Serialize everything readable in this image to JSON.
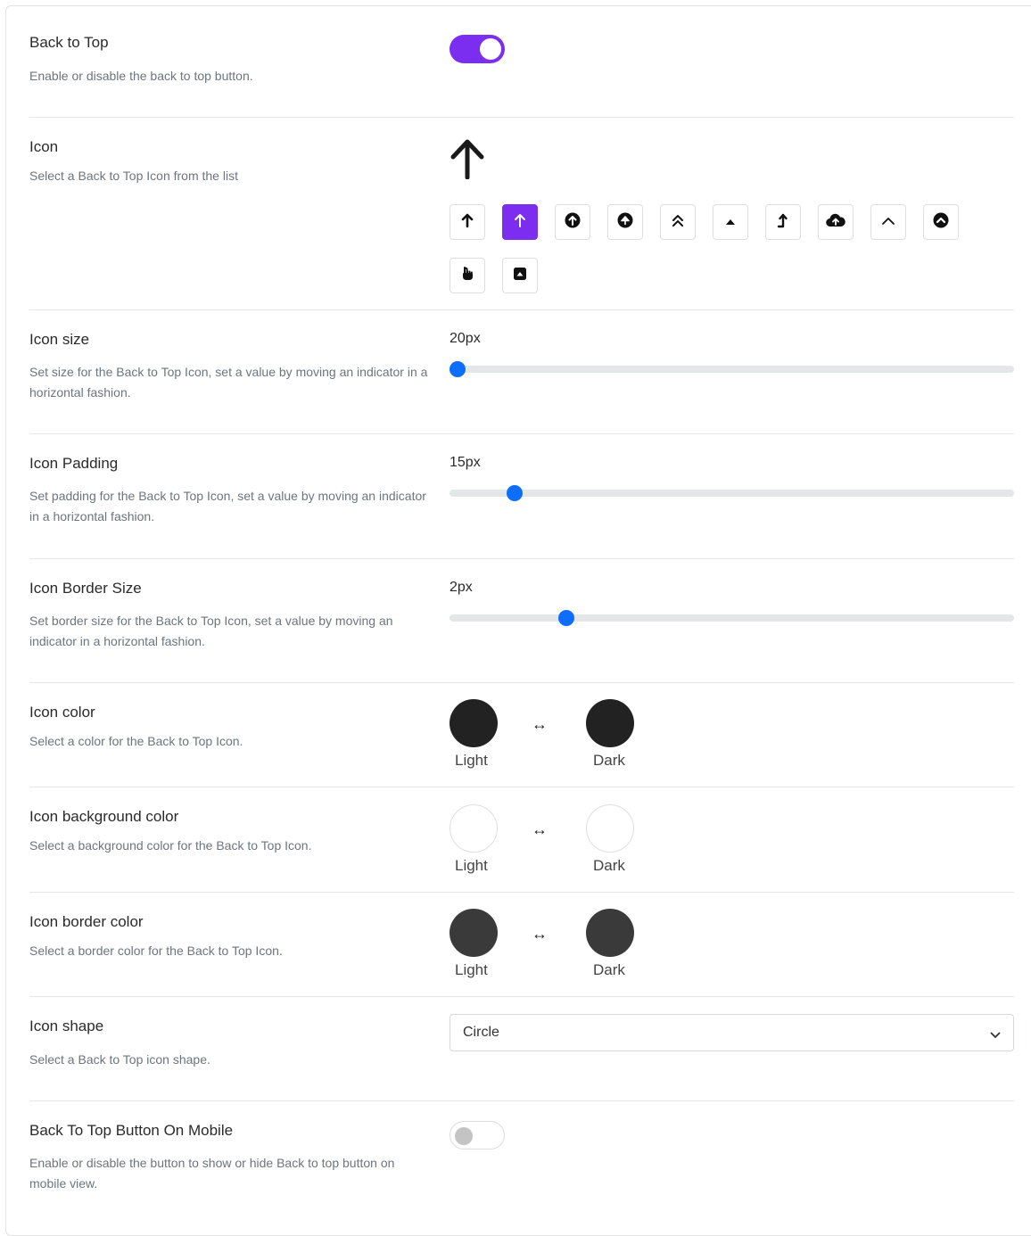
{
  "back_to_top": {
    "label": "Back to Top",
    "description": "Enable or disable the back to top button.",
    "enabled": true,
    "toggle_color": "#7c2ef0"
  },
  "icon": {
    "label": "Icon",
    "description": "Select a Back to Top Icon from the list",
    "preview_icon": "arrow-up-icon",
    "selected_index": 1,
    "options": [
      "arrow-up-bold-icon",
      "arrow-up-icon",
      "arrow-circle-up-icon",
      "arrow-circle-up-alt-icon",
      "double-chevron-up-icon",
      "caret-up-icon",
      "level-up-icon",
      "cloud-upload-icon",
      "chevron-up-icon",
      "chevron-circle-up-icon",
      "hand-pointer-up-icon",
      "caret-square-up-icon"
    ]
  },
  "icon_size": {
    "label": "Icon size",
    "description": "Set size for the Back to Top Icon, set a value by moving an indicator in a horizontal fashion.",
    "value_text": "20px",
    "position_fraction": 0.014
  },
  "icon_padding": {
    "label": "Icon Padding",
    "description": "Set padding for the Back to Top Icon, set a value by moving an indicator in a horizontal fashion.",
    "value_text": "15px",
    "position_fraction": 0.115
  },
  "icon_border_size": {
    "label": "Icon Border Size",
    "description": "Set border size for the Back to Top Icon, set a value by moving an indicator in a horizontal fashion.",
    "value_text": "2px",
    "position_fraction": 0.207
  },
  "icon_color": {
    "label": "Icon color",
    "description": "Select a color for the Back to Top Icon.",
    "light_label": "Light",
    "dark_label": "Dark",
    "light_color": "#222222",
    "dark_color": "#222222"
  },
  "icon_bg_color": {
    "label": "Icon background color",
    "description": "Select a background color for the Back to Top Icon.",
    "light_label": "Light",
    "dark_label": "Dark",
    "light_color": "#ffffff",
    "dark_color": "#ffffff"
  },
  "icon_border_color": {
    "label": "Icon border color",
    "description": "Select a border color for the Back to Top Icon.",
    "light_label": "Light",
    "dark_label": "Dark",
    "light_color": "#3a3a3a",
    "dark_color": "#3a3a3a"
  },
  "swap_glyph": "↔",
  "icon_shape": {
    "label": "Icon shape",
    "description": "Select a Back to Top icon shape.",
    "selected": "Circle"
  },
  "mobile": {
    "label": "Back To Top Button On Mobile",
    "description": "Enable or disable the button to show or hide Back to top button on mobile view.",
    "enabled": false
  }
}
